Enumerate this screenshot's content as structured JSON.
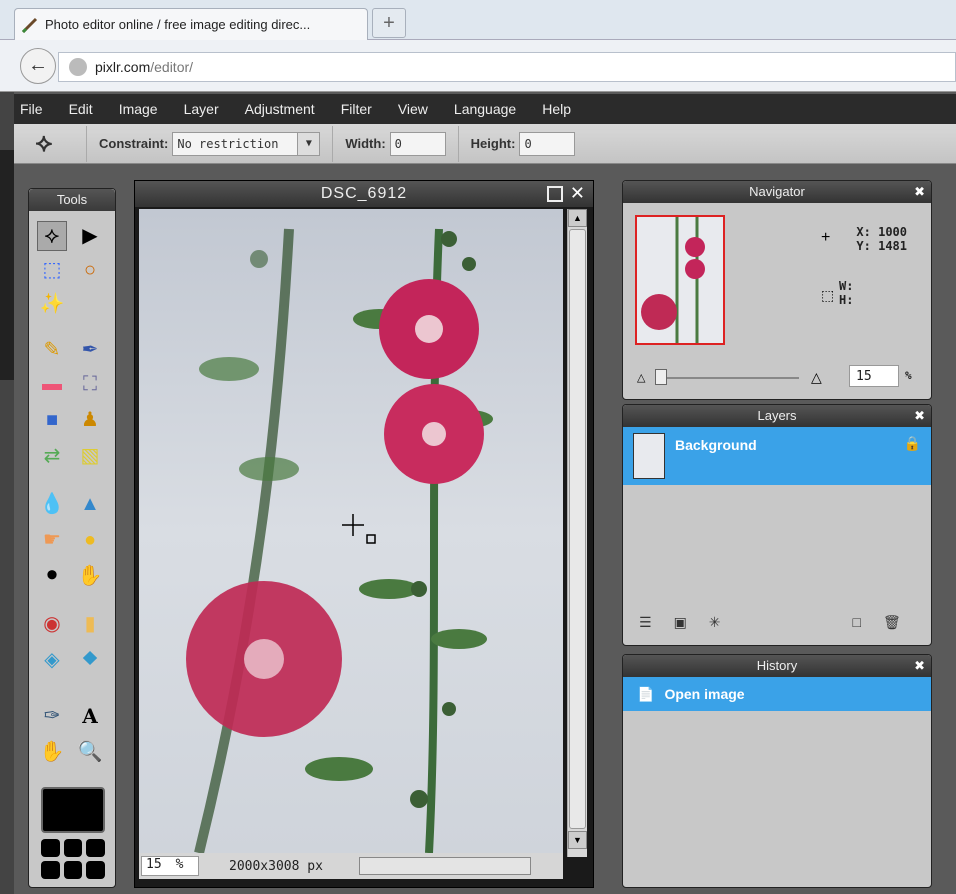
{
  "browser": {
    "tab_title": "Photo editor online / free image editing direc...",
    "new_tab": "+",
    "url_domain": "pixlr.com",
    "url_path": "/editor/"
  },
  "menu": [
    "File",
    "Edit",
    "Image",
    "Layer",
    "Adjustment",
    "Filter",
    "View",
    "Language",
    "Help"
  ],
  "tool_options": {
    "constraint_label": "Constraint:",
    "constraint_value": "No restriction",
    "width_label": "Width:",
    "width_value": "0",
    "height_label": "Height:",
    "height_value": "0"
  },
  "tools_panel": {
    "title": "Tools"
  },
  "canvas": {
    "title": "DSC_6912",
    "zoom_value": "15",
    "zoom_unit": "%",
    "dimensions": "2000x3008 px"
  },
  "navigator": {
    "title": "Navigator",
    "x_label": "X:",
    "x_value": "1000",
    "y_label": "Y:",
    "y_value": "1481",
    "w_label": "W:",
    "h_label": "H:",
    "zoom_value": "15",
    "zoom_unit": "%"
  },
  "layers": {
    "title": "Layers",
    "items": [
      {
        "name": "Background"
      }
    ]
  },
  "history": {
    "title": "History",
    "items": [
      {
        "name": "Open image"
      }
    ]
  },
  "colors": {
    "menubar": "#2b2b2b",
    "selection": "#3aa2e8",
    "panel": "#c8c8c8"
  }
}
